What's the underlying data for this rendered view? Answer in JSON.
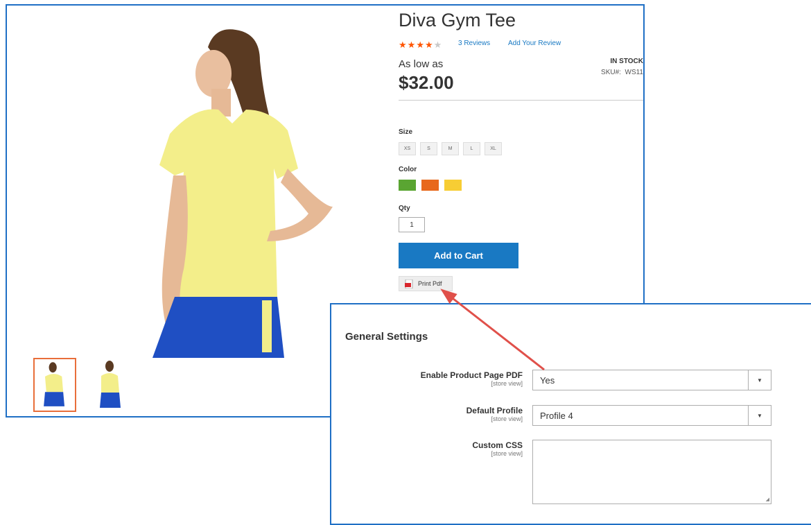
{
  "product": {
    "title": "Diva Gym Tee",
    "rating_stars_filled": 4,
    "rating_stars_total": 5,
    "reviews_link": "3  Reviews",
    "add_review_link": "Add Your Review",
    "as_low_as": "As low as",
    "price": "$32.00",
    "stock": "IN STOCK",
    "sku_label": "SKU#:",
    "sku_value": "WS11",
    "size_label": "Size",
    "sizes": [
      "XS",
      "S",
      "M",
      "L",
      "XL"
    ],
    "color_label": "Color",
    "colors": [
      "#5aa532",
      "#e8681c",
      "#f7cd34"
    ],
    "qty_label": "Qty",
    "qty_value": "1",
    "add_to_cart": "Add to Cart",
    "print_pdf": "Print Pdf"
  },
  "settings": {
    "title": "General Settings",
    "fields": [
      {
        "label": "Enable Product Page PDF",
        "scope": "[store view]",
        "value": "Yes"
      },
      {
        "label": "Default Profile",
        "scope": "[store view]",
        "value": "Profile 4"
      },
      {
        "label": "Custom CSS",
        "scope": "[store view]",
        "value": ""
      }
    ]
  },
  "colors": {
    "frame_border": "#1f6fc5",
    "button_blue": "#1979c3",
    "rating_orange": "#ff5501",
    "annotation_arrow": "#e0504a"
  }
}
